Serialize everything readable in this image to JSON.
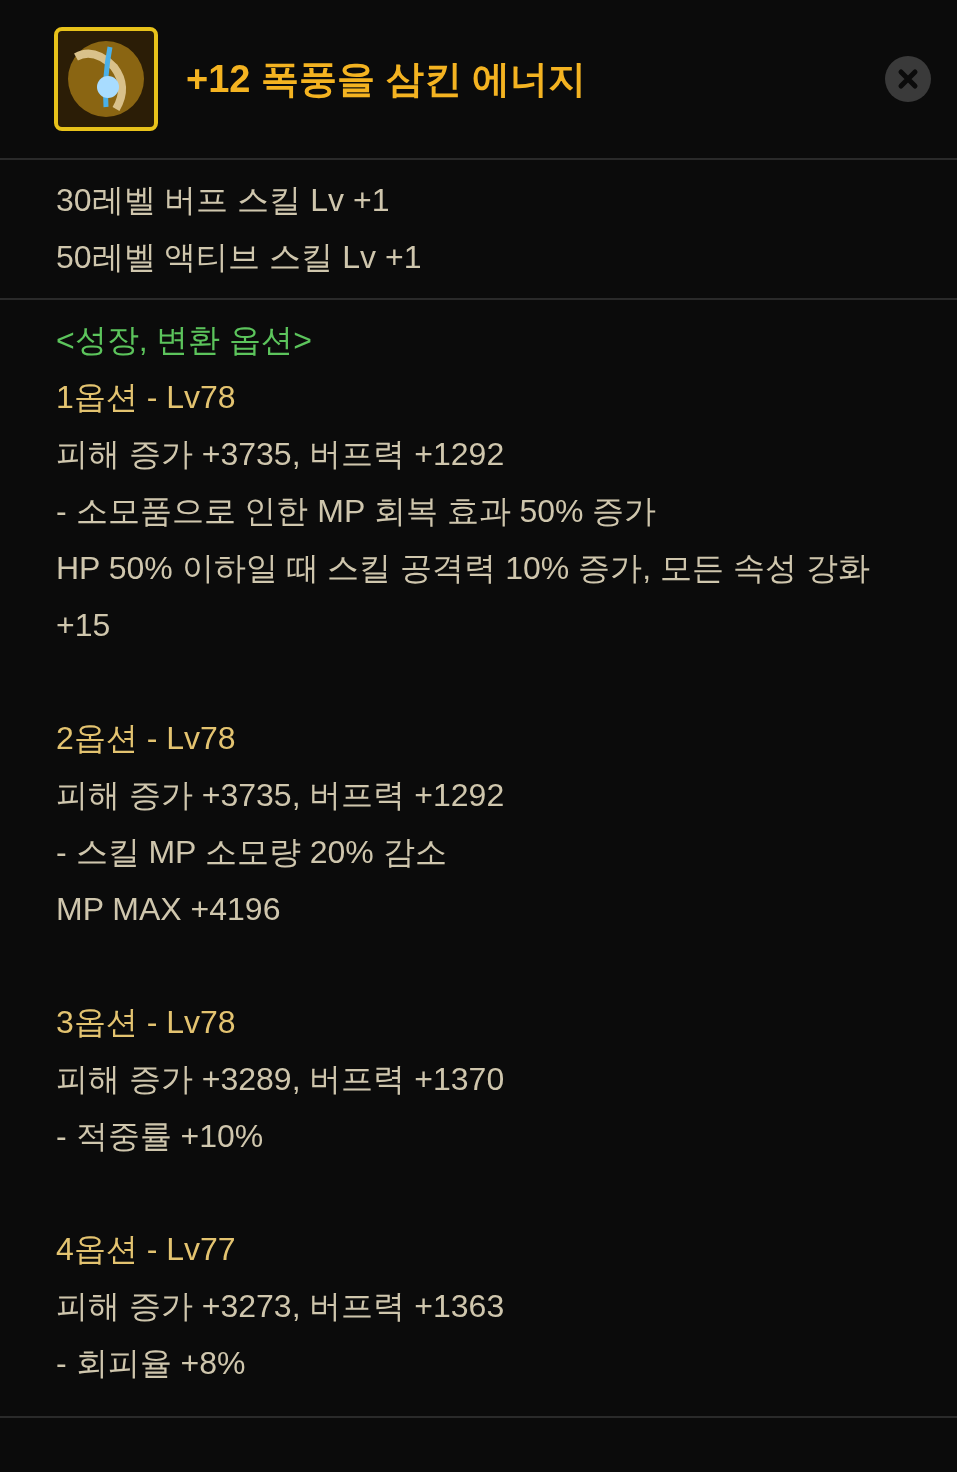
{
  "item": {
    "title": "+12 폭풍을 삼킨 에너지"
  },
  "skill_bonuses": [
    "30레벨 버프 스킬 Lv +1",
    "50레벨 액티브 스킬 Lv +1"
  ],
  "growth": {
    "heading": "<성장, 변환 옵션>",
    "options": [
      {
        "title": "1옵션 - Lv78",
        "lines": [
          "피해 증가 +3735, 버프력 +1292",
          "- 소모품으로 인한 MP 회복 효과 50% 증가",
          "HP 50% 이하일 때 스킬 공격력 10% 증가, 모든 속성 강화 +15"
        ]
      },
      {
        "title": "2옵션 - Lv78",
        "lines": [
          "피해 증가 +3735, 버프력 +1292",
          "- 스킬 MP 소모량 20% 감소",
          "MP MAX +4196"
        ]
      },
      {
        "title": "3옵션 - Lv78",
        "lines": [
          "피해 증가 +3289, 버프력 +1370",
          "- 적중률 +10%"
        ]
      },
      {
        "title": "4옵션 - Lv77",
        "lines": [
          "피해 증가 +3273, 버프력 +1363",
          "- 회피율 +8%"
        ]
      }
    ]
  }
}
